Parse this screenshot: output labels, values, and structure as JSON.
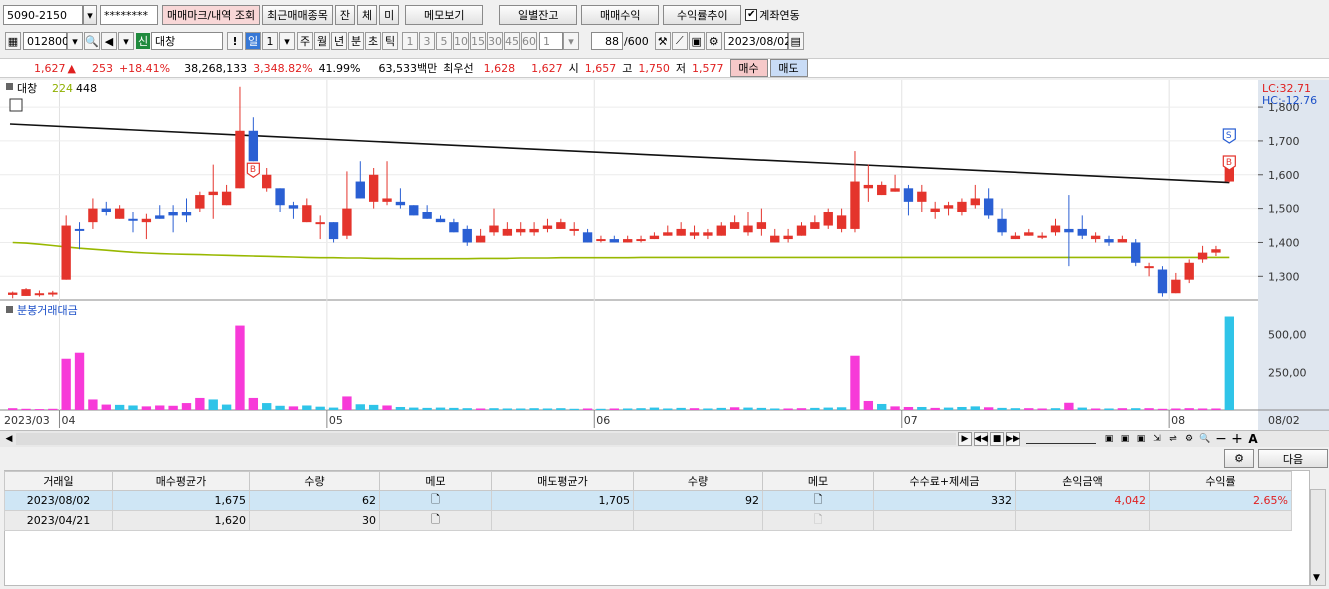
{
  "toolbar1": {
    "account": "5090-2150",
    "password": "********",
    "trade_mark_btn": "매매마크/내역 조회",
    "recent_btn": "최근매매종목",
    "jan_btn": "잔",
    "che_btn": "체",
    "mi_btn": "미",
    "memo_btn": "메모보기",
    "daily_btn": "일별잔고",
    "profit_btn": "매매수익",
    "trend_btn": "수익률추이",
    "link_label": "계좌연동"
  },
  "toolbar2": {
    "code": "012800",
    "sin_badge": "신",
    "name": "대창",
    "excl": "!",
    "il": "일",
    "num1": "1",
    "periods": [
      "주",
      "월",
      "년",
      "분",
      "초",
      "틱"
    ],
    "intervals": [
      "1",
      "3",
      "5",
      "10",
      "15",
      "30",
      "45",
      "60"
    ],
    "num2": "1",
    "count": "88",
    "count_total": "/600",
    "date": "2023/08/02"
  },
  "quote": {
    "price": "1,627",
    "arrow": "▲",
    "change": "253",
    "rate": "+18.41%",
    "volume": "38,268,133",
    "vol_rate": "3,348.82%",
    "turnover": "41.99%",
    "amount": "63,533백만",
    "best_label": "최우선",
    "best_ask": "1,628",
    "best_bid": "1,627",
    "open_label": "시",
    "open": "1,657",
    "high_label": "고",
    "high": "1,750",
    "low_label": "저",
    "low": "1,577",
    "buy_btn": "매수",
    "sell_btn": "매도"
  },
  "chart_data": {
    "type": "candlestick",
    "legend": [
      "대창",
      "224",
      "448"
    ],
    "lc": "LC:32.71",
    "hc": "HC:-12.76",
    "ylim": [
      1230,
      1880
    ],
    "yticks": [
      "1,800",
      "1,700",
      "1,600",
      "1,500",
      "1,400",
      "1,300"
    ],
    "volume_title": "분봉거래대금",
    "volume_ticks": [
      "500,00",
      "250,00"
    ],
    "volume_max": 650,
    "x_labels": [
      "2023/03",
      "04",
      "05",
      "06",
      "07",
      "08",
      "08/02"
    ],
    "candles": [
      [
        1245,
        1252,
        1240,
        1235,
        1255
      ],
      [
        1242,
        1262,
        1240,
        1255,
        1265
      ],
      [
        1245,
        1250,
        1240,
        1240,
        1258
      ],
      [
        1248,
        1252,
        1245,
        1240,
        1257
      ],
      [
        1290,
        1450,
        1450,
        1290,
        1480
      ],
      [
        1440,
        1435,
        1460,
        1380,
        1450
      ],
      [
        1460,
        1500,
        1500,
        1440,
        1530
      ],
      [
        1500,
        1490,
        1510,
        1480,
        1520
      ],
      [
        1470,
        1500,
        1505,
        1470,
        1510
      ],
      [
        1470,
        1465,
        1480,
        1430,
        1490
      ],
      [
        1460,
        1470,
        1480,
        1410,
        1485
      ],
      [
        1480,
        1470,
        1500,
        1470,
        1510
      ],
      [
        1490,
        1480,
        1510,
        1430,
        1500
      ],
      [
        1490,
        1480,
        1500,
        1460,
        1530
      ],
      [
        1500,
        1540,
        1550,
        1490,
        1540
      ],
      [
        1540,
        1550,
        1560,
        1470,
        1630
      ],
      [
        1510,
        1550,
        1550,
        1510,
        1570
      ],
      [
        1560,
        1730,
        1730,
        1560,
        1860
      ],
      [
        1730,
        1640,
        1740,
        1640,
        1770
      ],
      [
        1560,
        1600,
        1570,
        1550,
        1620
      ],
      [
        1560,
        1510,
        1560,
        1490,
        1550
      ],
      [
        1510,
        1500,
        1510,
        1470,
        1520
      ],
      [
        1460,
        1510,
        1510,
        1460,
        1530
      ],
      [
        1460,
        1460,
        1470,
        1410,
        1480
      ],
      [
        1460,
        1410,
        1460,
        1400,
        1460
      ],
      [
        1420,
        1500,
        1500,
        1410,
        1610
      ],
      [
        1580,
        1530,
        1530,
        1530,
        1640
      ],
      [
        1520,
        1600,
        1600,
        1500,
        1620
      ],
      [
        1520,
        1530,
        1540,
        1510,
        1640
      ],
      [
        1520,
        1510,
        1520,
        1500,
        1560
      ],
      [
        1510,
        1480,
        1510,
        1480,
        1510
      ],
      [
        1490,
        1470,
        1490,
        1470,
        1510
      ],
      [
        1470,
        1460,
        1470,
        1460,
        1480
      ],
      [
        1460,
        1430,
        1460,
        1430,
        1470
      ],
      [
        1440,
        1400,
        1440,
        1390,
        1450
      ],
      [
        1400,
        1420,
        1420,
        1400,
        1440
      ],
      [
        1430,
        1450,
        1450,
        1420,
        1500
      ],
      [
        1420,
        1440,
        1450,
        1420,
        1460
      ],
      [
        1430,
        1440,
        1440,
        1420,
        1460
      ],
      [
        1430,
        1440,
        1440,
        1420,
        1460
      ],
      [
        1440,
        1450,
        1460,
        1430,
        1470
      ],
      [
        1440,
        1460,
        1460,
        1440,
        1470
      ],
      [
        1440,
        1440,
        1460,
        1420,
        1460
      ],
      [
        1430,
        1400,
        1430,
        1400,
        1440
      ],
      [
        1410,
        1410,
        1410,
        1400,
        1420
      ],
      [
        1410,
        1400,
        1410,
        1400,
        1420
      ],
      [
        1400,
        1410,
        1410,
        1400,
        1420
      ],
      [
        1410,
        1410,
        1410,
        1400,
        1420
      ],
      [
        1410,
        1420,
        1420,
        1410,
        1430
      ],
      [
        1420,
        1430,
        1440,
        1420,
        1450
      ],
      [
        1420,
        1440,
        1440,
        1420,
        1460
      ],
      [
        1420,
        1430,
        1440,
        1410,
        1450
      ],
      [
        1420,
        1430,
        1430,
        1410,
        1440
      ],
      [
        1420,
        1450,
        1450,
        1420,
        1460
      ],
      [
        1440,
        1460,
        1470,
        1440,
        1480
      ],
      [
        1430,
        1450,
        1490,
        1420,
        1480
      ],
      [
        1440,
        1460,
        1470,
        1420,
        1500
      ],
      [
        1400,
        1420,
        1420,
        1400,
        1440
      ],
      [
        1410,
        1420,
        1430,
        1400,
        1440
      ],
      [
        1420,
        1450,
        1450,
        1420,
        1460
      ],
      [
        1440,
        1460,
        1470,
        1440,
        1480
      ],
      [
        1450,
        1490,
        1490,
        1440,
        1500
      ],
      [
        1440,
        1480,
        1490,
        1430,
        1500
      ],
      [
        1440,
        1580,
        1580,
        1430,
        1670
      ],
      [
        1560,
        1570,
        1590,
        1520,
        1630
      ],
      [
        1540,
        1570,
        1570,
        1540,
        1580
      ],
      [
        1550,
        1560,
        1560,
        1550,
        1600
      ],
      [
        1560,
        1520,
        1570,
        1480,
        1570
      ],
      [
        1520,
        1550,
        1550,
        1490,
        1570
      ],
      [
        1490,
        1500,
        1510,
        1470,
        1520
      ],
      [
        1500,
        1510,
        1510,
        1480,
        1520
      ],
      [
        1490,
        1520,
        1520,
        1480,
        1530
      ],
      [
        1510,
        1530,
        1540,
        1500,
        1570
      ],
      [
        1530,
        1480,
        1530,
        1470,
        1560
      ],
      [
        1470,
        1430,
        1470,
        1420,
        1500
      ],
      [
        1410,
        1420,
        1420,
        1410,
        1430
      ],
      [
        1420,
        1430,
        1430,
        1420,
        1440
      ],
      [
        1420,
        1420,
        1430,
        1410,
        1430
      ],
      [
        1430,
        1450,
        1450,
        1420,
        1470
      ],
      [
        1440,
        1430,
        1440,
        1330,
        1540
      ],
      [
        1440,
        1420,
        1450,
        1410,
        1480
      ],
      [
        1410,
        1420,
        1420,
        1400,
        1430
      ],
      [
        1410,
        1400,
        1410,
        1390,
        1420
      ],
      [
        1400,
        1410,
        1410,
        1400,
        1420
      ],
      [
        1400,
        1340,
        1410,
        1330,
        1410
      ],
      [
        1330,
        1330,
        1340,
        1300,
        1340
      ],
      [
        1320,
        1250,
        1330,
        1240,
        1330
      ],
      [
        1250,
        1290,
        1290,
        1250,
        1310
      ],
      [
        1290,
        1340,
        1340,
        1280,
        1350
      ],
      [
        1350,
        1370,
        1380,
        1340,
        1390
      ],
      [
        1370,
        1380,
        1380,
        1360,
        1390
      ],
      [
        1580,
        1627,
        1627,
        1577,
        1630
      ]
    ],
    "long_ma_start": 1750,
    "long_ma_end": 1577,
    "short_ma": [
      1400,
      1398,
      1395,
      1391,
      1387,
      1383,
      1380,
      1377,
      1374,
      1371,
      1369,
      1367,
      1366,
      1365,
      1364,
      1363,
      1362,
      1361,
      1360,
      1359,
      1358,
      1357,
      1356,
      1355,
      1355,
      1354,
      1354,
      1353,
      1353,
      1352,
      1352,
      1352,
      1352,
      1352,
      1352,
      1353,
      1353,
      1353,
      1354,
      1354,
      1354,
      1355,
      1355,
      1355,
      1355,
      1355,
      1355,
      1356,
      1356,
      1356,
      1356,
      1356,
      1356,
      1356,
      1356,
      1356,
      1356,
      1356,
      1356,
      1356,
      1356,
      1356,
      1356,
      1356,
      1356,
      1356,
      1356,
      1356,
      1356,
      1356,
      1356,
      1356,
      1356,
      1356,
      1356,
      1356,
      1356,
      1356,
      1356,
      1356,
      1356,
      1356,
      1356,
      1356,
      1356,
      1356,
      1356,
      1356,
      1356,
      1356,
      1356,
      1356,
      1356,
      1356
    ],
    "vol_colors": [
      "pink",
      "cyan"
    ],
    "volumes": [
      [
        12,
        0
      ],
      [
        8,
        0
      ],
      [
        6,
        0
      ],
      [
        8,
        0
      ],
      [
        340,
        0
      ],
      [
        380,
        0
      ],
      [
        70,
        0
      ],
      [
        36,
        0
      ],
      [
        34,
        1
      ],
      [
        30,
        1
      ],
      [
        24,
        0
      ],
      [
        30,
        0
      ],
      [
        28,
        0
      ],
      [
        46,
        0
      ],
      [
        80,
        0
      ],
      [
        70,
        1
      ],
      [
        36,
        1
      ],
      [
        560,
        0
      ],
      [
        80,
        0
      ],
      [
        46,
        1
      ],
      [
        28,
        1
      ],
      [
        24,
        0
      ],
      [
        30,
        1
      ],
      [
        22,
        1
      ],
      [
        16,
        1
      ],
      [
        90,
        0
      ],
      [
        38,
        1
      ],
      [
        34,
        1
      ],
      [
        30,
        0
      ],
      [
        20,
        1
      ],
      [
        16,
        1
      ],
      [
        14,
        1
      ],
      [
        16,
        1
      ],
      [
        14,
        1
      ],
      [
        12,
        1
      ],
      [
        10,
        0
      ],
      [
        12,
        1
      ],
      [
        10,
        1
      ],
      [
        10,
        1
      ],
      [
        12,
        1
      ],
      [
        10,
        1
      ],
      [
        12,
        1
      ],
      [
        8,
        1
      ],
      [
        10,
        0
      ],
      [
        8,
        1
      ],
      [
        10,
        0
      ],
      [
        10,
        1
      ],
      [
        12,
        1
      ],
      [
        16,
        1
      ],
      [
        10,
        1
      ],
      [
        14,
        1
      ],
      [
        12,
        0
      ],
      [
        10,
        1
      ],
      [
        14,
        1
      ],
      [
        18,
        0
      ],
      [
        16,
        1
      ],
      [
        14,
        1
      ],
      [
        10,
        1
      ],
      [
        10,
        0
      ],
      [
        12,
        0
      ],
      [
        14,
        1
      ],
      [
        16,
        1
      ],
      [
        18,
        1
      ],
      [
        360,
        0
      ],
      [
        60,
        0
      ],
      [
        40,
        1
      ],
      [
        24,
        0
      ],
      [
        20,
        0
      ],
      [
        20,
        1
      ],
      [
        14,
        0
      ],
      [
        16,
        1
      ],
      [
        20,
        1
      ],
      [
        24,
        1
      ],
      [
        18,
        0
      ],
      [
        14,
        1
      ],
      [
        12,
        1
      ],
      [
        12,
        0
      ],
      [
        10,
        0
      ],
      [
        12,
        1
      ],
      [
        48,
        0
      ],
      [
        16,
        1
      ],
      [
        10,
        0
      ],
      [
        10,
        1
      ],
      [
        12,
        0
      ],
      [
        12,
        1
      ],
      [
        12,
        0
      ],
      [
        8,
        0
      ],
      [
        10,
        0
      ],
      [
        12,
        0
      ],
      [
        10,
        0
      ],
      [
        10,
        0
      ],
      [
        620,
        1
      ]
    ],
    "markers": [
      {
        "i": 18,
        "label": "B",
        "type": "buy"
      },
      {
        "i": 91,
        "label": "B",
        "type": "buy"
      },
      {
        "i": 91,
        "label": "S",
        "type": "sell"
      }
    ]
  },
  "table": {
    "headers": [
      "거래일",
      "매수평균가",
      "수량",
      "메모",
      "매도평균가",
      "수량",
      "메모",
      "수수료+제세금",
      "손익금액",
      "수익률"
    ],
    "rows": [
      [
        "2023/08/02",
        "1,675",
        "62",
        "",
        "1,705",
        "92",
        "",
        "332",
        "4,042",
        "2.65%"
      ],
      [
        "2023/04/21",
        "1,620",
        "30",
        "",
        "",
        "",
        "",
        "",
        "",
        ""
      ]
    ],
    "next_btn": "다음"
  }
}
